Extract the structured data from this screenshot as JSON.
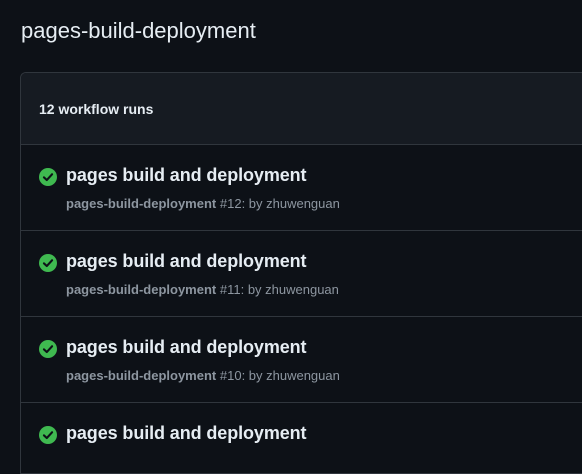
{
  "page": {
    "title": "pages-build-deployment"
  },
  "runs_header": {
    "count_label": "12 workflow runs"
  },
  "runs": [
    {
      "status": "success",
      "title": "pages build and deployment",
      "workflow": "pages-build-deployment",
      "run_number": "#12",
      "by_text": ": by zhuwenguan"
    },
    {
      "status": "success",
      "title": "pages build and deployment",
      "workflow": "pages-build-deployment",
      "run_number": "#11",
      "by_text": ": by zhuwenguan"
    },
    {
      "status": "success",
      "title": "pages build and deployment",
      "workflow": "pages-build-deployment",
      "run_number": "#10",
      "by_text": ": by zhuwenguan"
    },
    {
      "status": "success",
      "title": "pages build and deployment",
      "workflow": "",
      "run_number": "",
      "by_text": ""
    }
  ],
  "colors": {
    "background": "#0d1117",
    "header_bg": "#161b22",
    "border": "#30363d",
    "success": "#3fb950",
    "muted_text": "#8d96a0"
  },
  "icons": {
    "status_success": "check-circle-fill-icon"
  }
}
